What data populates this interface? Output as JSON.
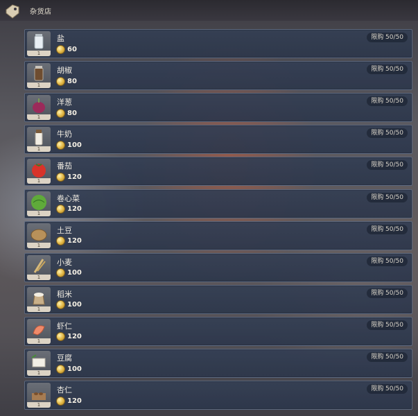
{
  "shop": {
    "title": "杂货店",
    "icon": "price-tag-icon"
  },
  "items": [
    {
      "name": "盐",
      "price": "60",
      "limit": "限购 50/50",
      "qty": "1",
      "icon": "salt-icon",
      "color": "#dfe6ec"
    },
    {
      "name": "胡椒",
      "price": "80",
      "limit": "限购 50/50",
      "qty": "1",
      "icon": "pepper-icon",
      "color": "#7a5a3a"
    },
    {
      "name": "洋葱",
      "price": "80",
      "limit": "限购 50/50",
      "qty": "1",
      "icon": "onion-icon",
      "color": "#9b2a5a"
    },
    {
      "name": "牛奶",
      "price": "100",
      "limit": "限购 50/50",
      "qty": "1",
      "icon": "milk-icon",
      "color": "#f1ede4"
    },
    {
      "name": "番茄",
      "price": "120",
      "limit": "限购 50/50",
      "qty": "1",
      "icon": "tomato-icon",
      "color": "#d8332a"
    },
    {
      "name": "卷心菜",
      "price": "120",
      "limit": "限购 50/50",
      "qty": "1",
      "icon": "cabbage-icon",
      "color": "#5faa3a"
    },
    {
      "name": "土豆",
      "price": "120",
      "limit": "限购 50/50",
      "qty": "1",
      "icon": "potato-icon",
      "color": "#b8915a"
    },
    {
      "name": "小麦",
      "price": "100",
      "limit": "限购 50/50",
      "qty": "1",
      "icon": "wheat-icon",
      "color": "#d7b979"
    },
    {
      "name": "稻米",
      "price": "100",
      "limit": "限购 50/50",
      "qty": "1",
      "icon": "rice-icon",
      "color": "#c9b08a"
    },
    {
      "name": "虾仁",
      "price": "120",
      "limit": "限购 50/50",
      "qty": "1",
      "icon": "shrimp-icon",
      "color": "#ef8a6a"
    },
    {
      "name": "豆腐",
      "price": "100",
      "limit": "限购 50/50",
      "qty": "1",
      "icon": "tofu-icon",
      "color": "#f3f0e6"
    },
    {
      "name": "杏仁",
      "price": "120",
      "limit": "限购 50/50",
      "qty": "1",
      "icon": "almond-icon",
      "color": "#9a6a3a"
    }
  ]
}
